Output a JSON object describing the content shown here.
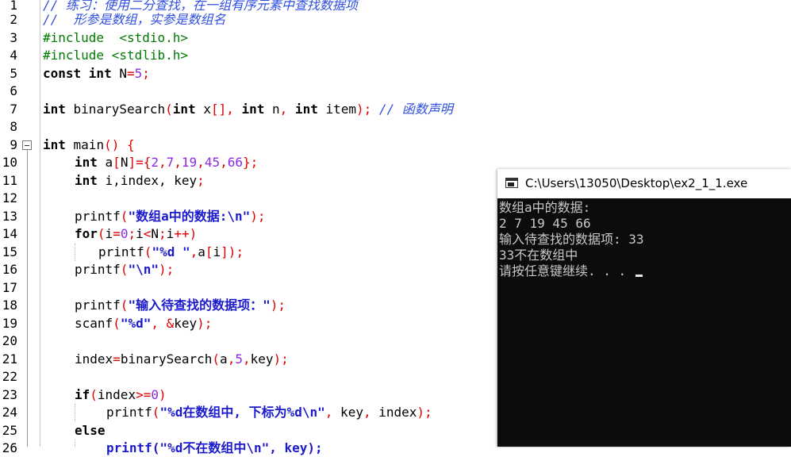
{
  "editor": {
    "line_numbers": [
      "1",
      "2",
      "3",
      "4",
      "5",
      "6",
      "7",
      "8",
      "9",
      "10",
      "11",
      "12",
      "13",
      "14",
      "15",
      "16",
      "17",
      "18",
      "19",
      "20",
      "21",
      "22",
      "23",
      "24",
      "25",
      "26"
    ],
    "l1_comment": "// 练习：使用二分查找，在一组有序元素中查找数据项",
    "l2_comment": "//  形参是数组，实参是数组名",
    "l3_pp": "#include  <stdio.h>",
    "l4_pp": "#include <stdlib.h>",
    "l5": {
      "kw1": "const int",
      "id": " N",
      "eq": "=",
      "num": "5",
      "semi": ";"
    },
    "l7": {
      "kw1": "int",
      "id1": " binarySearch",
      "p1": "(",
      "kw2": "int",
      "id2": " x",
      "p2": "[],",
      "kw3": " int",
      "id3": " n",
      "p3": ",",
      "kw4": " int",
      "id4": " item",
      "p4": ");",
      "comment": " // 函数声明"
    },
    "l9": {
      "kw": "int",
      "id": " main",
      "p": "() {"
    },
    "l10": {
      "kw": "int",
      "id1": " a",
      "p1": "[",
      "id2": "N",
      "p2": "]={",
      "n1": "2",
      "c1": ",",
      "n2": "7",
      "c2": ",",
      "n3": "19",
      "c3": ",",
      "n4": "45",
      "c4": ",",
      "n5": "66",
      "p3": "};"
    },
    "l11": {
      "kw": "int",
      "id": " i,index, key",
      "p": ";"
    },
    "l13": {
      "id": "printf",
      "p1": "(",
      "str": "\"数组a中的数据:\\n\"",
      "p2": ");"
    },
    "l14": {
      "kw": "for",
      "p1": "(",
      "id1": "i",
      "p2": "=",
      "n1": "0",
      "p3": ";",
      "id2": "i",
      "p4": "<",
      "id3": "N",
      "p5": ";",
      "id4": "i",
      "p6": "++)"
    },
    "l15": {
      "id": "printf",
      "p1": "(",
      "str": "\"%d \"",
      "p2": ",",
      "id2": "a",
      "p3": "[",
      "id3": "i",
      "p4": "]);"
    },
    "l16": {
      "id": "printf",
      "p1": "(",
      "str": "\"\\n\"",
      "p2": ");"
    },
    "l18": {
      "id": "printf",
      "p1": "(",
      "str": "\"输入待查找的数据项：\"",
      "p2": ");"
    },
    "l19": {
      "id": "scanf",
      "p1": "(",
      "str": "\"%d\"",
      "p2": ", &",
      "id2": "key",
      "p3": ");"
    },
    "l21": {
      "id1": "index",
      "p1": "=",
      "id2": "binarySearch",
      "p2": "(",
      "id3": "a",
      "p3": ",",
      "n1": "5",
      "p4": ",",
      "id4": "key",
      "p5": ");"
    },
    "l23": {
      "kw": "if",
      "p1": "(",
      "id": "index",
      "p2": ">=",
      "n": "0",
      "p3": ")"
    },
    "l24": {
      "id": "printf",
      "p1": "(",
      "str": "\"%d在数组中, 下标为%d\\n\"",
      "p2": ",",
      "id2": " key",
      "p3": ",",
      "id3": " index",
      "p4": ");"
    },
    "l25": {
      "kw": "else"
    },
    "l26_partial": "printf(\"%d不在数组中\\n\", key);"
  },
  "console": {
    "title": "C:\\Users\\13050\\Desktop\\ex2_1_1.exe",
    "lines": [
      "数组a中的数据:",
      "2 7 19 45 66",
      "输入待查找的数据项: 33",
      "33不在数组中",
      "请按任意键继续. . . "
    ]
  },
  "colors": {
    "comment": "#2f4fe0",
    "preprocessor": "#007a00",
    "operator": "#e00000",
    "number": "#8a2be2",
    "string": "#1a1acc",
    "console_bg": "#0c0c0c",
    "console_text": "#c8c8c8"
  }
}
